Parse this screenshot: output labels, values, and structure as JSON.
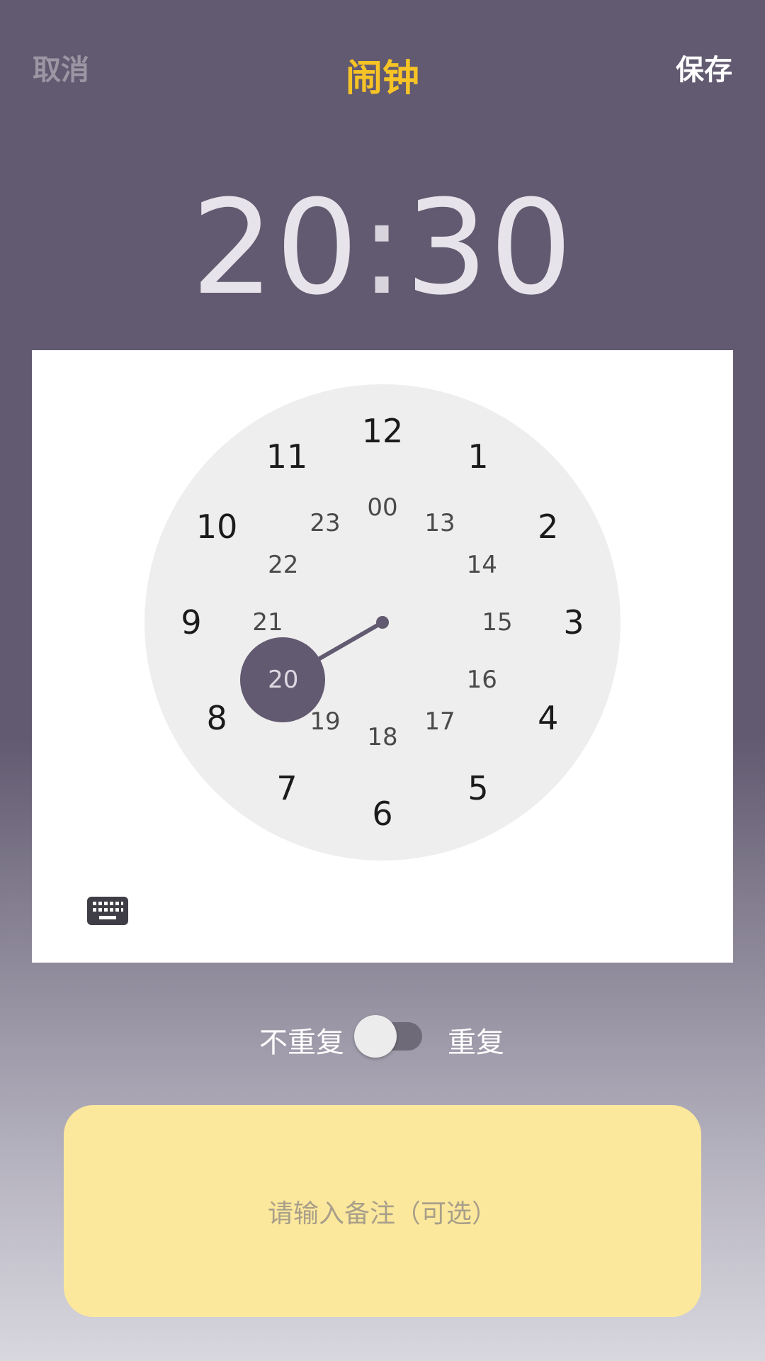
{
  "topbar": {
    "cancel": "取消",
    "title": "闹钟",
    "save": "保存"
  },
  "time": {
    "hours": "20",
    "minutes": "30",
    "separator": ":"
  },
  "dial": {
    "outer_hours": [
      "12",
      "1",
      "2",
      "3",
      "4",
      "5",
      "6",
      "7",
      "8",
      "9",
      "10",
      "11"
    ],
    "inner_hours": [
      "00",
      "13",
      "14",
      "15",
      "16",
      "17",
      "18",
      "19",
      "20",
      "21",
      "22",
      "23"
    ],
    "selected_hour": "20"
  },
  "repeat": {
    "off_label": "不重复",
    "on_label": "重复",
    "enabled": false
  },
  "note": {
    "placeholder": "请输入备注（可选）"
  },
  "colors": {
    "accent": "#625a70",
    "title": "#f8c425",
    "note_bg": "#fce89c",
    "dial_bg": "#eeeeee"
  },
  "icons": {
    "keyboard": "keyboard-icon"
  }
}
